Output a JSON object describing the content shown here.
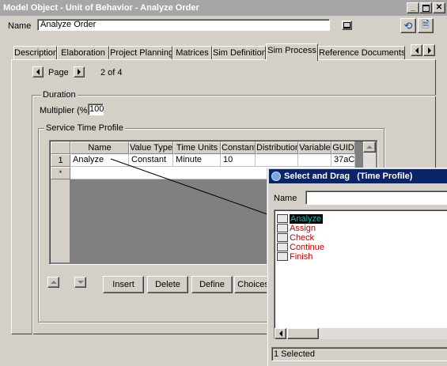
{
  "window": {
    "title": "Model Object - Unit of Behavior - Analyze Order",
    "name_label": "Name",
    "name_value": "Analyze Order"
  },
  "tabs": [
    {
      "label": "Description"
    },
    {
      "label": "Elaboration"
    },
    {
      "label": "Project Planning"
    },
    {
      "label": "Matrices"
    },
    {
      "label": "Sim Definition"
    },
    {
      "label": "Sim Process",
      "active": true
    },
    {
      "label": "Reference Documents"
    }
  ],
  "pager": {
    "label": "Page",
    "status": "2 of 4"
  },
  "duration": {
    "group_label": "Duration",
    "multiplier_label": "Multiplier (%)",
    "multiplier_value": "100"
  },
  "service_time": {
    "group_label": "Service Time Profile",
    "columns": [
      "Name",
      "Value Type",
      "Time Units",
      "Constant",
      "Distribution",
      "Variable",
      "GUID"
    ],
    "rows": [
      {
        "num": "1",
        "cells": [
          "Analyze",
          "Constant",
          "Minute",
          "10",
          "",
          "",
          "37aC"
        ]
      },
      {
        "num": "*",
        "cells": [
          "",
          "",
          "",
          "",
          "",
          "",
          ""
        ]
      }
    ],
    "buttons": {
      "insert": "Insert",
      "delete": "Delete",
      "define": "Define",
      "choices": "Choices"
    }
  },
  "drag_dialog": {
    "title": "Select and Drag   (Time Profile)",
    "name_label": "Name",
    "name_value": "",
    "items": [
      {
        "label": "Analyze",
        "selected": true
      },
      {
        "label": "Assign"
      },
      {
        "label": "Check"
      },
      {
        "label": "Continue"
      },
      {
        "label": "Finish"
      }
    ],
    "status": "1 Selected"
  },
  "colors": {
    "item_red": "#c00000",
    "selected_bg": "#000000",
    "selected_text": "#00c0c0",
    "titlebar_inactive": "#a6a6a6",
    "dialog_title": "#0a246a"
  }
}
